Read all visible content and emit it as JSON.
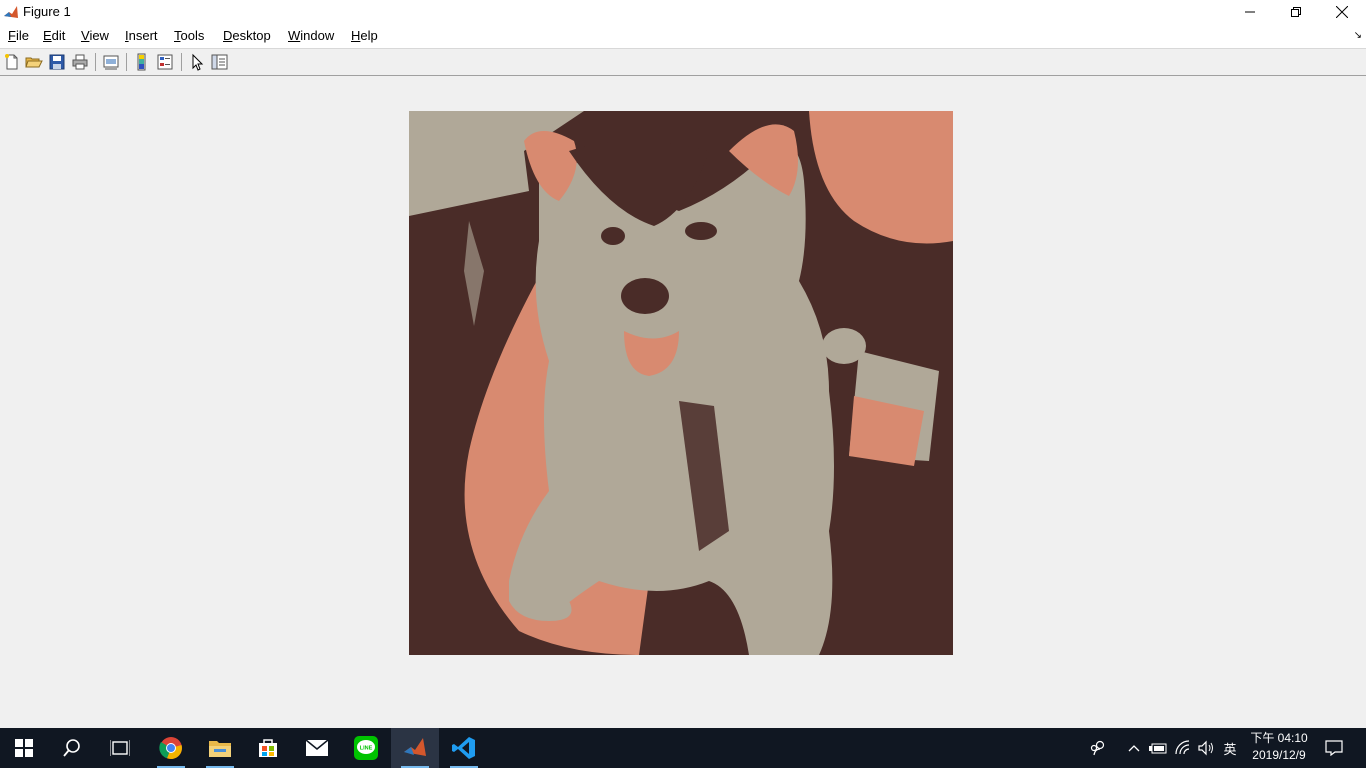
{
  "window": {
    "title": "Figure 1"
  },
  "menu": [
    {
      "accel": "F",
      "rest": "ile"
    },
    {
      "accel": "E",
      "rest": "dit"
    },
    {
      "accel": "V",
      "rest": "iew"
    },
    {
      "accel": "I",
      "rest": "nsert"
    },
    {
      "accel": "T",
      "rest": "ools"
    },
    {
      "accel": "D",
      "rest": "esktop"
    },
    {
      "accel": "W",
      "rest": "indow"
    },
    {
      "accel": "H",
      "rest": "elp"
    }
  ],
  "toolbar": {
    "icons": [
      "new-figure-icon",
      "open-file-icon",
      "save-figure-icon",
      "print-figure-icon",
      "link-plot-icon",
      "insert-colorbar-icon",
      "insert-legend-icon",
      "edit-plot-icon",
      "property-inspector-icon"
    ]
  },
  "figure": {
    "image_palette": [
      "#b0a898",
      "#4a2c28",
      "#d88a70"
    ]
  },
  "taskbar": {
    "apps": [
      "start-icon",
      "search-icon",
      "task-view-icon",
      "chrome-icon",
      "file-explorer-icon",
      "store-icon",
      "mail-icon",
      "line-icon",
      "matlab-icon",
      "vscode-icon"
    ],
    "active_app": "matlab-icon",
    "clock_time": "下午 04:10",
    "clock_date": "2019/12/9",
    "ime": "英"
  },
  "colors": {
    "taskbar_bg": "#101722",
    "accent": "#76b9ed"
  }
}
